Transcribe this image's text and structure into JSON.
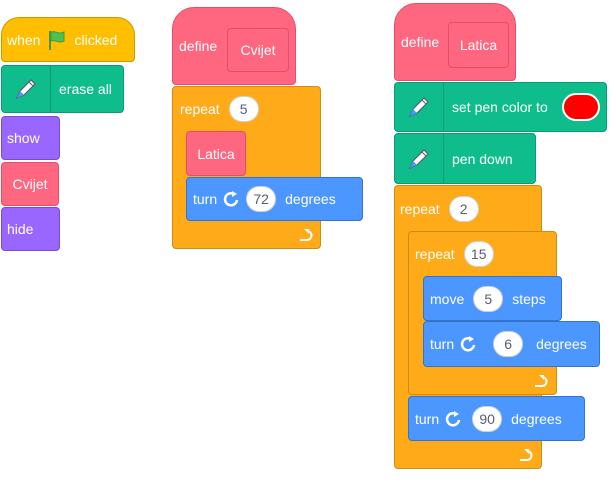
{
  "colors": {
    "events": "#ffbf00",
    "pen": "#0fbd8c",
    "looks": "#9966ff",
    "custom": "#ff6680",
    "control": "#ffab19",
    "motion": "#4c97ff",
    "pen_color_value": "#ff0000"
  },
  "script1": {
    "when_label": "when",
    "flag_icon": "green-flag-icon",
    "clicked_label": "clicked",
    "erase_all_label": "erase all",
    "show_label": "show",
    "call_cvijet_label": "Cvijet",
    "hide_label": "hide"
  },
  "script2": {
    "define_label": "define",
    "define_name": "Cvijet",
    "repeat_label": "repeat",
    "repeat_count": "5",
    "call_latica_label": "Latica",
    "turn_label": "turn",
    "turn_value": "72",
    "degrees_label": "degrees"
  },
  "script3": {
    "define_label": "define",
    "define_name": "Latica",
    "set_pen_color_label": "set pen color to",
    "pen_down_label": "pen down",
    "repeat_label": "repeat",
    "outer_repeat_count": "2",
    "inner_repeat_count": "15",
    "move_label": "move",
    "move_value": "5",
    "steps_label": "steps",
    "turn_label": "turn",
    "inner_turn_value": "6",
    "outer_turn_value": "90",
    "degrees_label": "degrees"
  }
}
